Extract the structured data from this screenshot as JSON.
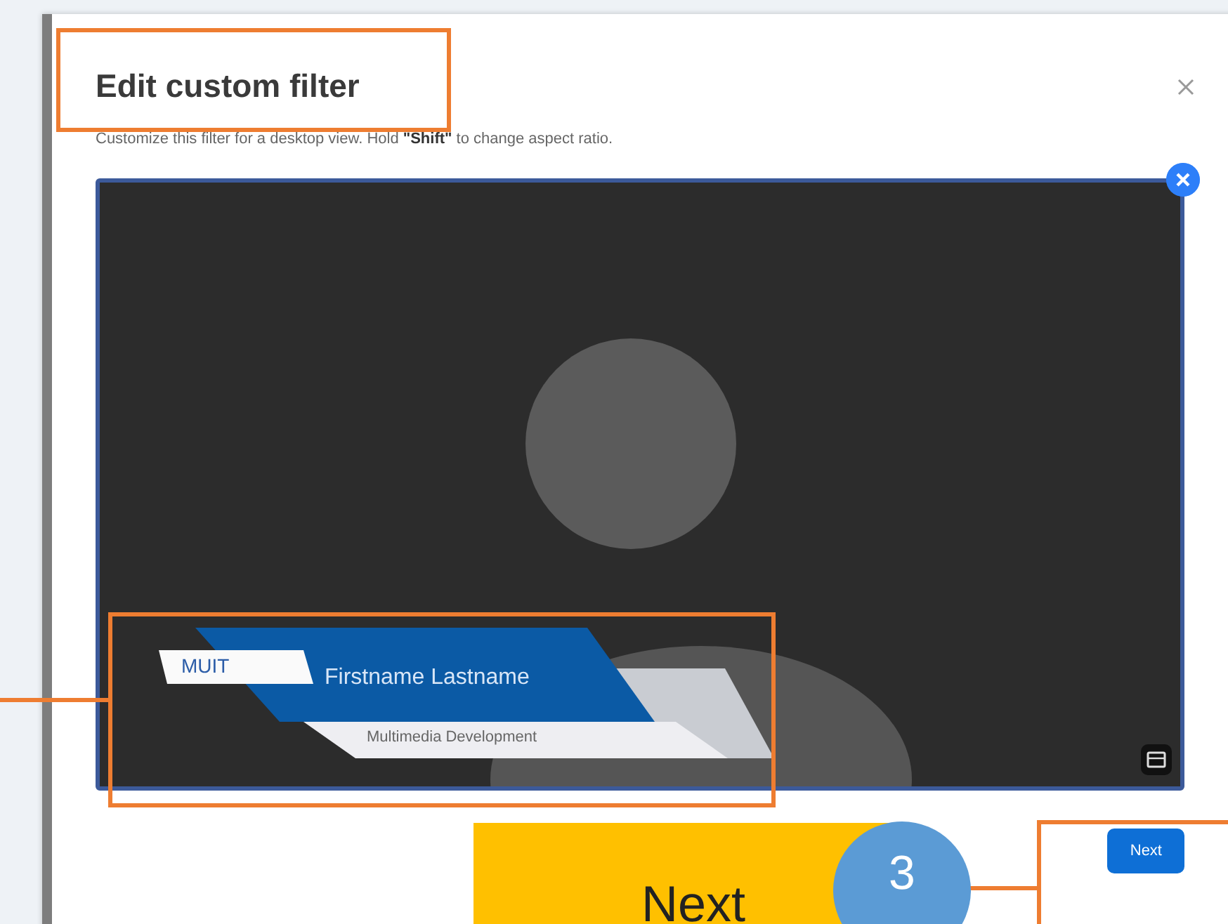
{
  "dialog": {
    "title": "Edit custom filter",
    "description": "Customize this filter for a desktop view. Hold **\"Shift\"** to change aspect ratio.",
    "preview": {
      "organization": "MUIT",
      "name": "Firstname Lastname",
      "department": "Multimedia Development"
    },
    "next_button": "Next"
  },
  "callout": {
    "label": "Next",
    "step": "3"
  }
}
